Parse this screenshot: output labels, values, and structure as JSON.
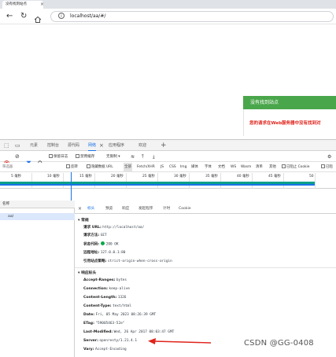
{
  "browser": {
    "tab_title": "没有找到站点",
    "url": "localhost/aa/#/"
  },
  "not_found": {
    "header": "没有找到站点",
    "message": "您的请求在Web服务器中没有找到对"
  },
  "devtools": {
    "tabs": [
      "元素",
      "控制台",
      "源代码",
      "网络",
      "应用程序",
      "欢迎"
    ],
    "active_tab": "网络",
    "toolbar": {
      "preserve_log": "保留日志",
      "disable_cache": "禁用缓存",
      "throttle": "无限制"
    },
    "filter": {
      "placeholder": "筛选器",
      "invert": "反转",
      "hide_data_urls": "隐藏数据 URL",
      "all": "全部",
      "types": [
        "Fetch/XHR",
        "JS",
        "CSS",
        "Img",
        "媒体",
        "字体",
        "文档",
        "WS",
        "Wasm",
        "清单",
        "其他"
      ],
      "blocked_cookies": "已阻止 Cookie",
      "blocked_requests": "已阻"
    },
    "timeline_ticks": [
      "5 毫秒",
      "10 毫秒",
      "15 毫秒",
      "20 毫秒",
      "25 毫秒",
      "30 毫秒",
      "35 毫秒",
      "40 毫秒",
      "45 毫秒",
      "50"
    ],
    "request_list": {
      "header": "名称",
      "item": "aa/"
    },
    "details": {
      "tabs": [
        "标头",
        "预览",
        "响应",
        "发起程序",
        "计时",
        "Cookie"
      ],
      "active_tab": "标头",
      "general": {
        "title": "常规",
        "rows": [
          {
            "key": "请求 URL:",
            "value": "http://localhost/aa/"
          },
          {
            "key": "请求方法:",
            "value": "GET"
          },
          {
            "key": "状态代码:",
            "value": "200 OK"
          },
          {
            "key": "远程地址:",
            "value": "127.0.0.1:80"
          },
          {
            "key": "引用站点策略:",
            "value": "strict-origin-when-cross-origin"
          }
        ]
      },
      "response_headers": {
        "title": "响应标头",
        "rows": [
          {
            "key": "Accept-Ranges:",
            "value": "bytes"
          },
          {
            "key": "Connection:",
            "value": "keep-alive"
          },
          {
            "key": "Content-Length:",
            "value": "1326"
          },
          {
            "key": "Content-Type:",
            "value": "text/html"
          },
          {
            "key": "Date:",
            "value": "Fri, 05 May 2023 08:26:39 GMT"
          },
          {
            "key": "ETag:",
            "value": "\"59005463-52e\""
          },
          {
            "key": "Last-Modified:",
            "value": "Wed, 26 Apr 2017 08:03:47 GMT"
          },
          {
            "key": "Server:",
            "value": "openresty/1.21.4.1"
          },
          {
            "key": "Vary:",
            "value": "Accept-Encoding"
          }
        ]
      }
    }
  },
  "watermark": "CSDN @GG-0408",
  "colors": {
    "accent": "#1a73e8",
    "success_header": "#4aa64b",
    "error_text": "#e0231b",
    "timeline_bar": "#0aa08a",
    "annotation_arrow": "#e0231b"
  }
}
